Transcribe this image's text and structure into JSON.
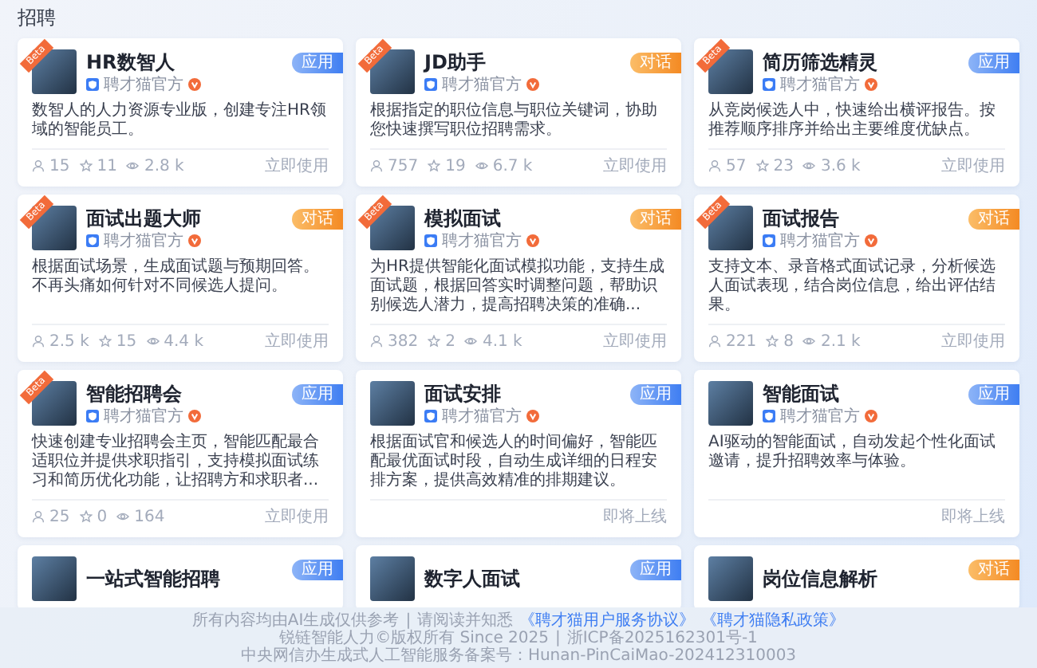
{
  "page_title": "招聘",
  "cards": [
    {
      "title": "HR数智人",
      "author": "聘才猫官方",
      "beta": "Beta",
      "tag": {
        "kind": "app",
        "label": "应用"
      },
      "description": "数智人的人力资源专业版，创建专注HR领域的智能员工。",
      "stats": {
        "users": "15",
        "stars": "11",
        "views": "2.8 k"
      },
      "action": "立即使用"
    },
    {
      "title": "JD助手",
      "author": "聘才猫官方",
      "beta": "Beta",
      "tag": {
        "kind": "chat",
        "label": "对话"
      },
      "description": "根据指定的职位信息与职位关键词，协助您快速撰写职位招聘需求。",
      "stats": {
        "users": "757",
        "stars": "19",
        "views": "6.7 k"
      },
      "action": "立即使用"
    },
    {
      "title": "简历筛选精灵",
      "author": "聘才猫官方",
      "beta": "Beta",
      "tag": {
        "kind": "app",
        "label": "应用"
      },
      "description": "从竞岗候选人中，快速给出横评报告。按推荐顺序排序并给出主要维度优缺点。",
      "stats": {
        "users": "57",
        "stars": "23",
        "views": "3.6 k"
      },
      "action": "立即使用"
    },
    {
      "title": "面试出题大师",
      "author": "聘才猫官方",
      "beta": "Beta",
      "tag": {
        "kind": "chat",
        "label": "对话"
      },
      "description": "根据面试场景，生成面试题与预期回答。不再头痛如何针对不同候选人提问。",
      "stats": {
        "users": "2.5 k",
        "stars": "15",
        "views": "4.4 k"
      },
      "action": "立即使用"
    },
    {
      "title": "模拟面试",
      "author": "聘才猫官方",
      "beta": "Beta",
      "tag": {
        "kind": "chat",
        "label": "对话"
      },
      "description": "为HR提供智能化面试模拟功能，支持生成面试题，根据回答实时调整问题，帮助识别候选人潜力，提高招聘决策的准确...",
      "stats": {
        "users": "382",
        "stars": "2",
        "views": "4.1 k"
      },
      "action": "立即使用"
    },
    {
      "title": "面试报告",
      "author": "聘才猫官方",
      "beta": "Beta",
      "tag": {
        "kind": "chat",
        "label": "对话"
      },
      "description": "支持文本、录音格式面试记录，分析候选人面试表现，结合岗位信息，给出评估结果。",
      "stats": {
        "users": "221",
        "stars": "8",
        "views": "2.1 k"
      },
      "action": "立即使用"
    },
    {
      "title": "智能招聘会",
      "author": "聘才猫官方",
      "beta": "Beta",
      "tag": {
        "kind": "app",
        "label": "应用"
      },
      "description": "快速创建专业招聘会主页，智能匹配最合适职位并提供求职指引，支持模拟面试练习和简历优化功能，让招聘方和求职者...",
      "stats": {
        "users": "25",
        "stars": "0",
        "views": "164"
      },
      "action": "立即使用"
    },
    {
      "title": "面试安排",
      "author": "聘才猫官方",
      "tag": {
        "kind": "app",
        "label": "应用"
      },
      "description": "根据面试官和候选人的时间偏好，智能匹配最优面试时段，自动生成详细的日程安排方案，提供高效精准的排期建议。",
      "action": "即将上线"
    },
    {
      "title": "智能面试",
      "author": "聘才猫官方",
      "tag": {
        "kind": "app",
        "label": "应用"
      },
      "description": "AI驱动的智能面试，自动发起个性化面试邀请，提升招聘效率与体验。",
      "action": "即将上线"
    },
    {
      "title": "一站式智能招聘",
      "tag": {
        "kind": "app",
        "label": "应用"
      }
    },
    {
      "title": "数字人面试",
      "tag": {
        "kind": "app",
        "label": "应用"
      }
    },
    {
      "title": "岗位信息解析",
      "tag": {
        "kind": "chat",
        "label": "对话"
      }
    }
  ],
  "footer": {
    "notice": "所有内容均由AI生成仅供参考",
    "separator": "|",
    "read_prompt": "请阅读并知悉",
    "links": [
      "《聘才猫用户服务协议》",
      "《聘才猫隐私政策》"
    ],
    "copyright": "锐链智能人力©版权所有 Since 2025",
    "separator_2": "|",
    "icp": "浙ICP备2025162301号-1",
    "filing": "中央网信办生成式人工智能服务备案号：Hunan-PinCaiMao-202412310003"
  }
}
